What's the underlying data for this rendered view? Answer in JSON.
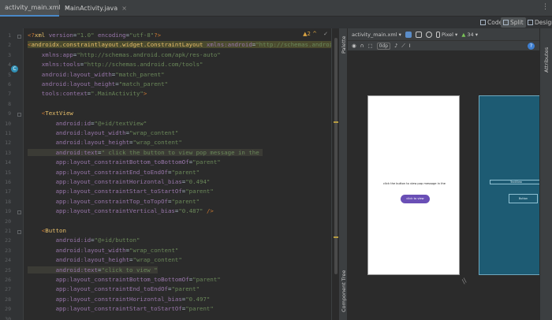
{
  "tabs": [
    {
      "label": "activity_main.xml",
      "icon_color": "#e0a030",
      "close": "×"
    },
    {
      "label": "MainActivity.java",
      "icon_color": "#3f8fd0",
      "close": "×"
    }
  ],
  "tab_menu": "⋮",
  "view_modes": {
    "code": "Code",
    "split": "Split",
    "design": "Design"
  },
  "editor": {
    "warnings": "▲2 ^",
    "gutter_numbers": [
      "1",
      "2",
      "3",
      "4",
      "5",
      "6",
      "7",
      "8",
      "9",
      "10",
      "11",
      "12",
      "13",
      "14",
      "15",
      "16",
      "17",
      "18",
      "19",
      "20",
      "21",
      "22",
      "23",
      "24",
      "25",
      "26",
      "27",
      "28",
      "29",
      "30"
    ],
    "lines": [
      {
        "parts": [
          [
            "punct",
            "<?"
          ],
          [
            "tag",
            "xml"
          ],
          [
            "attr",
            " version"
          ],
          [
            "plain",
            "="
          ],
          [
            "val",
            "\"1.0\""
          ],
          [
            "attr",
            " encoding"
          ],
          [
            "plain",
            "="
          ],
          [
            "val",
            "\"utf-8\""
          ],
          [
            "punct",
            "?>"
          ]
        ]
      },
      {
        "parts": [
          [
            "punct",
            "<"
          ],
          [
            "tag",
            "androidx.constraintlayout.widget.ConstraintLayout"
          ],
          [
            "attr",
            " xmlns:android"
          ],
          [
            "plain",
            "="
          ],
          [
            "val",
            "\"http://schemas.android.com/ap"
          ]
        ],
        "hl": true
      },
      {
        "parts": [
          [
            "attr",
            "    xmlns:app"
          ],
          [
            "plain",
            "="
          ],
          [
            "val",
            "\"http://schemas.android.com/apk/res-auto\""
          ]
        ]
      },
      {
        "parts": [
          [
            "attr",
            "    xmlns:tools"
          ],
          [
            "plain",
            "="
          ],
          [
            "val",
            "\"http://schemas.android.com/tools\""
          ]
        ]
      },
      {
        "parts": [
          [
            "attr",
            "    android:layout_width"
          ],
          [
            "plain",
            "="
          ],
          [
            "val",
            "\"match_parent\""
          ]
        ]
      },
      {
        "parts": [
          [
            "attr",
            "    android:layout_height"
          ],
          [
            "plain",
            "="
          ],
          [
            "val",
            "\"match_parent\""
          ]
        ]
      },
      {
        "parts": [
          [
            "attr",
            "    tools:context"
          ],
          [
            "plain",
            "="
          ],
          [
            "val",
            "\".MainActivity\""
          ],
          [
            "punct",
            ">"
          ]
        ]
      },
      {
        "parts": [
          [
            "plain",
            ""
          ]
        ]
      },
      {
        "parts": [
          [
            "punct",
            "    <"
          ],
          [
            "tag",
            "TextView"
          ]
        ]
      },
      {
        "parts": [
          [
            "attr",
            "        android:id"
          ],
          [
            "plain",
            "="
          ],
          [
            "val",
            "\"@+id/textView\""
          ]
        ]
      },
      {
        "parts": [
          [
            "attr",
            "        android:layout_width"
          ],
          [
            "plain",
            "="
          ],
          [
            "val",
            "\"wrap_content\""
          ]
        ]
      },
      {
        "parts": [
          [
            "attr",
            "        android:layout_height"
          ],
          [
            "plain",
            "="
          ],
          [
            "val",
            "\"wrap_content\""
          ]
        ]
      },
      {
        "parts": [
          [
            "attr",
            "        android:text"
          ],
          [
            "plain",
            "="
          ],
          [
            "val",
            "\" click the button to view pop message in the "
          ]
        ],
        "hl2": true
      },
      {
        "parts": [
          [
            "attr",
            "        app:layout_constraintBottom_toBottomOf"
          ],
          [
            "plain",
            "="
          ],
          [
            "val",
            "\"parent\""
          ]
        ]
      },
      {
        "parts": [
          [
            "attr",
            "        app:layout_constraintEnd_toEndOf"
          ],
          [
            "plain",
            "="
          ],
          [
            "val",
            "\"parent\""
          ]
        ]
      },
      {
        "parts": [
          [
            "attr",
            "        app:layout_constraintHorizontal_bias"
          ],
          [
            "plain",
            "="
          ],
          [
            "val",
            "\"0.494\""
          ]
        ]
      },
      {
        "parts": [
          [
            "attr",
            "        app:layout_constraintStart_toStartOf"
          ],
          [
            "plain",
            "="
          ],
          [
            "val",
            "\"parent\""
          ]
        ]
      },
      {
        "parts": [
          [
            "attr",
            "        app:layout_constraintTop_toTopOf"
          ],
          [
            "plain",
            "="
          ],
          [
            "val",
            "\"parent\""
          ]
        ]
      },
      {
        "parts": [
          [
            "attr",
            "        app:layout_constraintVertical_bias"
          ],
          [
            "plain",
            "="
          ],
          [
            "val",
            "\"0.487\""
          ],
          [
            "punct",
            " />"
          ]
        ]
      },
      {
        "parts": [
          [
            "plain",
            ""
          ]
        ]
      },
      {
        "parts": [
          [
            "punct",
            "    <"
          ],
          [
            "tag",
            "Button"
          ]
        ]
      },
      {
        "parts": [
          [
            "attr",
            "        android:id"
          ],
          [
            "plain",
            "="
          ],
          [
            "val",
            "\"@+id/button\""
          ]
        ]
      },
      {
        "parts": [
          [
            "attr",
            "        android:layout_width"
          ],
          [
            "plain",
            "="
          ],
          [
            "val",
            "\"wrap_content\""
          ]
        ]
      },
      {
        "parts": [
          [
            "attr",
            "        android:layout_height"
          ],
          [
            "plain",
            "="
          ],
          [
            "val",
            "\"wrap_content\""
          ]
        ]
      },
      {
        "parts": [
          [
            "attr",
            "        android:text"
          ],
          [
            "plain",
            "="
          ],
          [
            "val",
            "\"click to view \""
          ]
        ],
        "hl2": true
      },
      {
        "parts": [
          [
            "attr",
            "        app:layout_constraintBottom_toBottomOf"
          ],
          [
            "plain",
            "="
          ],
          [
            "val",
            "\"parent\""
          ]
        ]
      },
      {
        "parts": [
          [
            "attr",
            "        app:layout_constraintEnd_toEndOf"
          ],
          [
            "plain",
            "="
          ],
          [
            "val",
            "\"parent\""
          ]
        ]
      },
      {
        "parts": [
          [
            "attr",
            "        app:layout_constraintHorizontal_bias"
          ],
          [
            "plain",
            "="
          ],
          [
            "val",
            "\"0.497\""
          ]
        ]
      },
      {
        "parts": [
          [
            "attr",
            "        app:layout_constraintStart_toStartOf"
          ],
          [
            "plain",
            "="
          ],
          [
            "val",
            "\"parent\""
          ]
        ]
      }
    ]
  },
  "side_panels": {
    "palette": "Palette",
    "component_tree": "Component Tree",
    "attributes": "Attributes"
  },
  "design_toolbar": {
    "file": "activity_main.xml",
    "device": "Pixel",
    "api": "34",
    "dp": "0dp"
  },
  "preview": {
    "textview_text": "click the button to view pop message in the",
    "button_text": "click to view",
    "blueprint_textview": "TextView",
    "blueprint_button": "Button"
  },
  "colors": {
    "accent": "#4a88c7",
    "button": "#6a4fb6",
    "blueprint": "#1d5b73"
  }
}
